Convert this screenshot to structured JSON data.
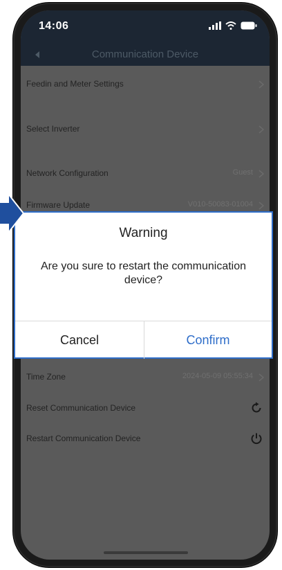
{
  "status_bar": {
    "time": "14:06",
    "icons": [
      "signal-icon",
      "wifi-icon",
      "battery-icon"
    ]
  },
  "nav": {
    "title": "Communication Device",
    "back_icon": "chevron-left-icon"
  },
  "list": {
    "items": [
      {
        "label": "Feedin and Meter Settings",
        "value": "",
        "icon": "chevron-right-icon"
      },
      {
        "label": "Select Inverter",
        "value": "",
        "icon": "chevron-right-icon"
      },
      {
        "label": "Network Configuration",
        "value": "Guest",
        "icon": "chevron-right-icon"
      },
      {
        "label": "Firmware Update",
        "value": "V010-50083-01004",
        "icon": "chevron-right-icon"
      },
      {
        "label": "Time Zone",
        "value": "2024-05-09 05:55:34",
        "icon": "chevron-right-icon"
      },
      {
        "label": "Reset Communication Device",
        "value": "",
        "icon": "reset-icon"
      },
      {
        "label": "Restart Communication Device",
        "value": "",
        "icon": "power-icon"
      }
    ]
  },
  "dialog": {
    "title": "Warning",
    "message": "Are you sure to restart the communication device?",
    "cancel_label": "Cancel",
    "confirm_label": "Confirm"
  },
  "colors": {
    "header_bg": "#1c2633",
    "overlay_bg": "#5a5a5a",
    "accent": "#2e6dc9",
    "pointer": "#1f4f9e"
  }
}
